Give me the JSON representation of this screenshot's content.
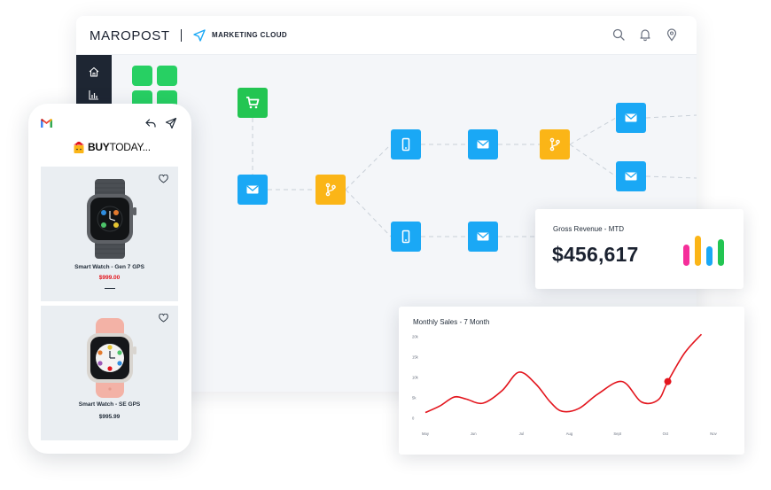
{
  "header": {
    "logo": "MAROPOST",
    "product": "MARKETING CLOUD"
  },
  "icons": {
    "search": "search-icon",
    "bell": "bell-icon",
    "location": "location-pin-icon",
    "home": "home-icon",
    "analytics": "bar-chart-icon",
    "cart": "cart-icon",
    "email": "email-icon",
    "mobile": "mobile-icon",
    "branch": "branch-icon"
  },
  "colors": {
    "green": "#23c552",
    "blue": "#1aa8f5",
    "yellow": "#fbb517",
    "sidebar": "#1e2633",
    "line": "#e3151d"
  },
  "phone": {
    "brand_bold": "BUY",
    "brand_light": "TODAY...",
    "products": [
      {
        "title": "Smart Watch - Gen 7 GPS",
        "price": "$999.00"
      },
      {
        "title": "Smart Watch - SE GPS",
        "price": "$995.99"
      }
    ]
  },
  "revenue": {
    "label": "Gross Revenue - MTD",
    "value": "$456,617"
  },
  "chart_data": {
    "type": "line",
    "title": "Monthly Sales - 7 Month",
    "x_ticks": [
      "May",
      "Jun",
      "Jul",
      "Aug",
      "Sept",
      "Oct",
      "Nov"
    ],
    "y_ticks": [
      "20k",
      "15k",
      "10k",
      "5k",
      "0"
    ],
    "ylim": [
      0,
      20
    ],
    "series": [
      {
        "values": [
          {
            "x": 0.0,
            "y": 1.4
          },
          {
            "x": 0.3,
            "y": 3.0
          },
          {
            "x": 0.6,
            "y": 5.2
          },
          {
            "x": 0.85,
            "y": 4.7
          },
          {
            "x": 1.2,
            "y": 3.7
          },
          {
            "x": 1.6,
            "y": 6.8
          },
          {
            "x": 1.95,
            "y": 11.3
          },
          {
            "x": 2.3,
            "y": 8.4
          },
          {
            "x": 2.6,
            "y": 4.0
          },
          {
            "x": 2.85,
            "y": 1.7
          },
          {
            "x": 3.2,
            "y": 2.4
          },
          {
            "x": 3.6,
            "y": 6.0
          },
          {
            "x": 4.1,
            "y": 9.0
          },
          {
            "x": 4.5,
            "y": 4.0
          },
          {
            "x": 4.85,
            "y": 4.5
          },
          {
            "x": 5.05,
            "y": 9.0
          },
          {
            "x": 5.4,
            "y": 16.0
          },
          {
            "x": 5.75,
            "y": 20.6
          }
        ]
      }
    ],
    "highlight": {
      "x": 5.05,
      "y": 9.0
    },
    "grid": false,
    "legend": "none"
  }
}
